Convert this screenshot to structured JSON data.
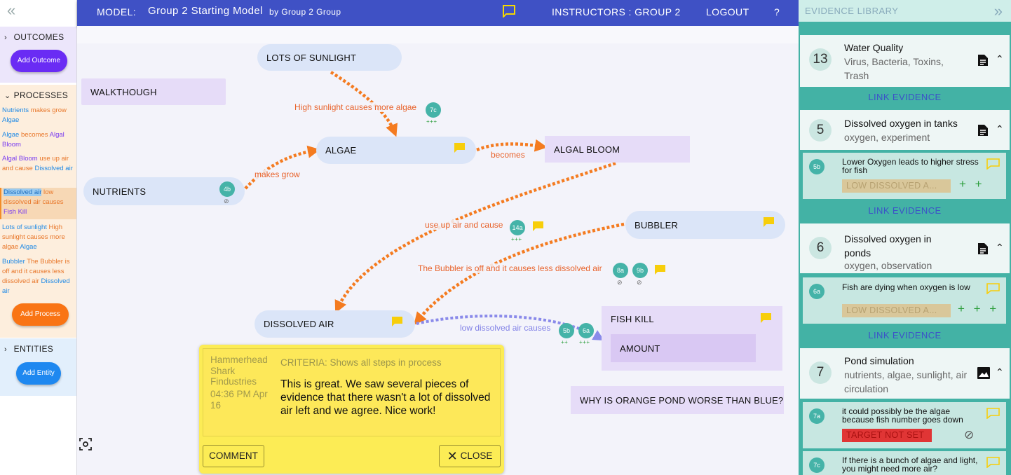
{
  "left": {
    "outcomes_label": "OUTCOMES",
    "add_outcome": "Add Outcome",
    "processes_label": "PROCESSES",
    "add_process": "Add Process",
    "entities_label": "ENTITIES",
    "add_entity": "Add Entity",
    "processes": [
      {
        "a": "Nutrients",
        "verb": "makes grow",
        "b": "Algae"
      },
      {
        "a": "Algae",
        "verb": "becomes",
        "b": "Algal Bloom"
      },
      {
        "a": "Algal Bloom",
        "verb": "use up air and cause",
        "b": "Dissolved air"
      },
      {
        "a": "Dissolved air",
        "verb": "low dissolved air causes",
        "b": "Fish Kill"
      },
      {
        "a": "Lots of sunlight",
        "verb": "High sunlight causes more algae",
        "b": "Algae"
      },
      {
        "a": "Bubbler",
        "verb": "The Bubbler is off and it causes less dissolved air",
        "b": "Dissolved air"
      }
    ]
  },
  "topbar": {
    "model_label": "MODEL:",
    "model_name": "Group 2 Starting Model",
    "by": "by Group 2 Group",
    "instructors": "INSTRUCTORS : GROUP 2",
    "logout": "LOGOUT",
    "help": "?"
  },
  "canvas": {
    "nodes": {
      "sunlight": "LOTS OF SUNLIGHT",
      "walkthrough": "WALKTHOUGH",
      "algae": "ALGAE",
      "algal_bloom": "ALGAL BLOOM",
      "nutrients": "NUTRIENTS",
      "bubbler": "BUBBLER",
      "dissolved_air": "DISSOLVED AIR",
      "fish_kill": "FISH KILL",
      "amount": "AMOUNT",
      "question": "WHY IS ORANGE POND WORSE THAN BLUE?"
    },
    "labels": {
      "sunlight": "High sunlight causes more algae",
      "becomes": "becomes",
      "makes_grow": "makes grow",
      "use_up": "use up air and cause",
      "bubbler": "The Bubbler is off and it causes less dissolved air",
      "low_air": "low dissolved air causes"
    },
    "evidence": {
      "e7c": "7c",
      "e4b": "4b",
      "e14a": "14a",
      "e8a": "8a",
      "e9b": "9b",
      "e5b": "5b",
      "e6a": "6a",
      "plus3": "+++",
      "plus2": "++",
      "null": "⊘"
    },
    "comment": {
      "author": "Hammerhead Shark Findustries",
      "time": "04:36 PM Apr 16",
      "criteria": "CRITERIA: Shows all steps in process",
      "text": "This is great. We saw several pieces of evidence that there wasn't a lot of dissolved air left and we agree. Nice work!",
      "comment_btn": "COMMENT",
      "close_btn": "CLOSE"
    }
  },
  "library": {
    "title": "EVIDENCE LIBRARY",
    "link_label": "LINK EVIDENCE",
    "cards": [
      {
        "num": "13",
        "title": "Water Quality",
        "sub": "Virus, Bacteria, Toxins, Trash"
      },
      {
        "num": "5",
        "title": "Dissolved oxygen in tanks",
        "sub": "oxygen, experiment"
      },
      {
        "num": "6",
        "title": "Dissolved oxygen in ponds",
        "sub": "oxygen, observation"
      },
      {
        "num": "7",
        "title": "Pond simulation",
        "sub": "nutrients, algae, sunlight, air circulation"
      }
    ],
    "subs": [
      {
        "id": "5b",
        "text": "Lower Oxygen leads to higher stress for fish",
        "tag": "LOW DISSOLVED A...",
        "rating": "+ +"
      },
      {
        "id": "6a",
        "text": "Fish are dying when oxygen is low",
        "tag": "LOW DISSOLVED A...",
        "rating": "+ + +"
      },
      {
        "id": "7a",
        "text": "it could possibly be the algae because fish number goes down",
        "tag": "TARGET NOT SET",
        "rating": "⊘"
      },
      {
        "id": "7c",
        "text": "If there is a bunch of algae and light, you might need more air?"
      }
    ]
  },
  "colors": {
    "topbar": "#3f51c5",
    "library": "#43b2a5",
    "orange": "#f47b20",
    "purple_edge": "#8a8aea",
    "comment": "#fcec55"
  }
}
